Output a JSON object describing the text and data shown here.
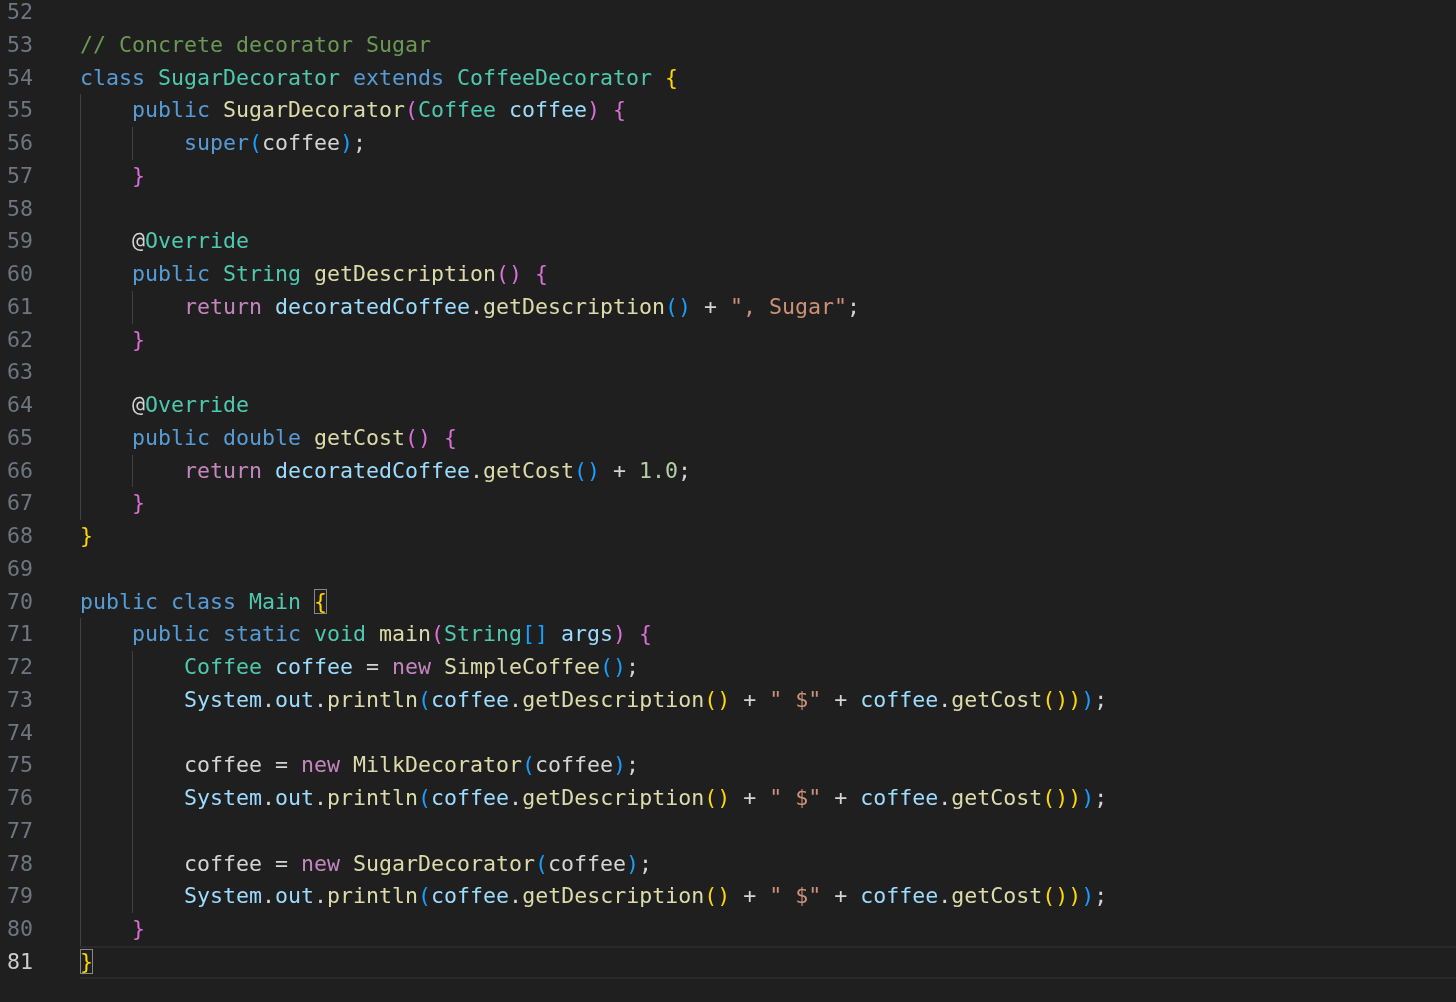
{
  "editor": {
    "lines": [
      {
        "number": "52",
        "current": false
      },
      {
        "number": "53",
        "current": false,
        "tokens": [
          {
            "text": "// Concrete decorator Sugar",
            "kind": "comment"
          }
        ]
      },
      {
        "number": "54",
        "current": false,
        "tokens": [
          {
            "text": "class ",
            "kind": "keyword"
          },
          {
            "text": "SugarDecorator ",
            "kind": "type"
          },
          {
            "text": "extends ",
            "kind": "keyword"
          },
          {
            "text": "CoffeeDecorator ",
            "kind": "type"
          },
          {
            "text": "{",
            "kind": "bracket1"
          }
        ]
      },
      {
        "number": "55",
        "current": false,
        "tokens": [
          {
            "text": "    public ",
            "kind": "keyword"
          },
          {
            "text": "SugarDecorator",
            "kind": "function"
          },
          {
            "text": "(",
            "kind": "bracket2"
          },
          {
            "text": "Coffee ",
            "kind": "type"
          },
          {
            "text": "coffee",
            "kind": "variable"
          },
          {
            "text": ") {",
            "kind": "bracket2"
          }
        ]
      },
      {
        "number": "56",
        "current": false,
        "tokens": [
          {
            "text": "        super",
            "kind": "keyword"
          },
          {
            "text": "(",
            "kind": "bracket3"
          },
          {
            "text": "coffee",
            "kind": "plain"
          },
          {
            "text": ")",
            "kind": "bracket3"
          },
          {
            "text": ";",
            "kind": "plain"
          }
        ]
      },
      {
        "number": "57",
        "current": false,
        "tokens": [
          {
            "text": "    }",
            "kind": "bracket2"
          }
        ]
      },
      {
        "number": "58",
        "current": false
      },
      {
        "number": "59",
        "current": false,
        "tokens": [
          {
            "text": "    @",
            "kind": "plain"
          },
          {
            "text": "Override",
            "kind": "type"
          }
        ]
      },
      {
        "number": "60",
        "current": false,
        "tokens": [
          {
            "text": "    public ",
            "kind": "keyword"
          },
          {
            "text": "String ",
            "kind": "type"
          },
          {
            "text": "getDescription",
            "kind": "function"
          },
          {
            "text": "() {",
            "kind": "bracket2"
          }
        ]
      },
      {
        "number": "61",
        "current": false,
        "tokens": [
          {
            "text": "        return ",
            "kind": "control"
          },
          {
            "text": "decoratedCoffee",
            "kind": "variable"
          },
          {
            "text": ".",
            "kind": "plain"
          },
          {
            "text": "getDescription",
            "kind": "function"
          },
          {
            "text": "()",
            "kind": "bracket3"
          },
          {
            "text": " + ",
            "kind": "plain"
          },
          {
            "text": "\", Sugar\"",
            "kind": "string"
          },
          {
            "text": ";",
            "kind": "plain"
          }
        ]
      },
      {
        "number": "62",
        "current": false,
        "tokens": [
          {
            "text": "    }",
            "kind": "bracket2"
          }
        ]
      },
      {
        "number": "63",
        "current": false
      },
      {
        "number": "64",
        "current": false,
        "tokens": [
          {
            "text": "    @",
            "kind": "plain"
          },
          {
            "text": "Override",
            "kind": "type"
          }
        ]
      },
      {
        "number": "65",
        "current": false,
        "tokens": [
          {
            "text": "    public double ",
            "kind": "keyword"
          },
          {
            "text": "getCost",
            "kind": "function"
          },
          {
            "text": "() {",
            "kind": "bracket2"
          }
        ]
      },
      {
        "number": "66",
        "current": false,
        "tokens": [
          {
            "text": "        return ",
            "kind": "control"
          },
          {
            "text": "decoratedCoffee",
            "kind": "variable"
          },
          {
            "text": ".",
            "kind": "plain"
          },
          {
            "text": "getCost",
            "kind": "function"
          },
          {
            "text": "()",
            "kind": "bracket3"
          },
          {
            "text": " + ",
            "kind": "plain"
          },
          {
            "text": "1.0",
            "kind": "number"
          },
          {
            "text": ";",
            "kind": "plain"
          }
        ]
      },
      {
        "number": "67",
        "current": false,
        "tokens": [
          {
            "text": "    }",
            "kind": "bracket2"
          }
        ]
      },
      {
        "number": "68",
        "current": false,
        "tokens": [
          {
            "text": "}",
            "kind": "bracket1"
          }
        ]
      },
      {
        "number": "69",
        "current": false
      },
      {
        "number": "70",
        "current": false,
        "tokens": [
          {
            "text": "public class ",
            "kind": "keyword"
          },
          {
            "text": "Main ",
            "kind": "type"
          },
          {
            "text": "{",
            "kind": "bracket1-matched"
          }
        ]
      },
      {
        "number": "71",
        "current": false,
        "tokens": [
          {
            "text": "    public static ",
            "kind": "keyword"
          },
          {
            "text": "void ",
            "kind": "type"
          },
          {
            "text": "main",
            "kind": "function"
          },
          {
            "text": "(",
            "kind": "bracket2"
          },
          {
            "text": "String",
            "kind": "type"
          },
          {
            "text": "[] ",
            "kind": "bracket3"
          },
          {
            "text": "args",
            "kind": "variable"
          },
          {
            "text": ") {",
            "kind": "bracket2"
          }
        ]
      },
      {
        "number": "72",
        "current": false,
        "tokens": [
          {
            "text": "        Coffee ",
            "kind": "type"
          },
          {
            "text": "coffee",
            "kind": "variable"
          },
          {
            "text": " = ",
            "kind": "plain"
          },
          {
            "text": "new ",
            "kind": "control"
          },
          {
            "text": "SimpleCoffee",
            "kind": "function"
          },
          {
            "text": "()",
            "kind": "bracket3"
          },
          {
            "text": ";",
            "kind": "plain"
          }
        ]
      },
      {
        "number": "73",
        "current": false,
        "tokens": [
          {
            "text": "        System",
            "kind": "variable"
          },
          {
            "text": ".",
            "kind": "plain"
          },
          {
            "text": "out",
            "kind": "variable"
          },
          {
            "text": ".",
            "kind": "plain"
          },
          {
            "text": "println",
            "kind": "function"
          },
          {
            "text": "(",
            "kind": "bracket3"
          },
          {
            "text": "coffee",
            "kind": "variable"
          },
          {
            "text": ".",
            "kind": "plain"
          },
          {
            "text": "getDescription",
            "kind": "function"
          },
          {
            "text": "()",
            "kind": "bracket1"
          },
          {
            "text": " + ",
            "kind": "plain"
          },
          {
            "text": "\" $\"",
            "kind": "string"
          },
          {
            "text": " + ",
            "kind": "plain"
          },
          {
            "text": "coffee",
            "kind": "variable"
          },
          {
            "text": ".",
            "kind": "plain"
          },
          {
            "text": "getCost",
            "kind": "function"
          },
          {
            "text": "())",
            "kind": "bracket1"
          },
          {
            "text": ")",
            "kind": "bracket3"
          },
          {
            "text": ";",
            "kind": "plain"
          }
        ]
      },
      {
        "number": "74",
        "current": false
      },
      {
        "number": "75",
        "current": false,
        "tokens": [
          {
            "text": "        coffee = ",
            "kind": "plain"
          },
          {
            "text": "new ",
            "kind": "control"
          },
          {
            "text": "MilkDecorator",
            "kind": "function"
          },
          {
            "text": "(",
            "kind": "bracket3"
          },
          {
            "text": "coffee",
            "kind": "plain"
          },
          {
            "text": ")",
            "kind": "bracket3"
          },
          {
            "text": ";",
            "kind": "plain"
          }
        ]
      },
      {
        "number": "76",
        "current": false,
        "tokens": [
          {
            "text": "        System",
            "kind": "variable"
          },
          {
            "text": ".",
            "kind": "plain"
          },
          {
            "text": "out",
            "kind": "variable"
          },
          {
            "text": ".",
            "kind": "plain"
          },
          {
            "text": "println",
            "kind": "function"
          },
          {
            "text": "(",
            "kind": "bracket3"
          },
          {
            "text": "coffee",
            "kind": "variable"
          },
          {
            "text": ".",
            "kind": "plain"
          },
          {
            "text": "getDescription",
            "kind": "function"
          },
          {
            "text": "()",
            "kind": "bracket1"
          },
          {
            "text": " + ",
            "kind": "plain"
          },
          {
            "text": "\" $\"",
            "kind": "string"
          },
          {
            "text": " + ",
            "kind": "plain"
          },
          {
            "text": "coffee",
            "kind": "variable"
          },
          {
            "text": ".",
            "kind": "plain"
          },
          {
            "text": "getCost",
            "kind": "function"
          },
          {
            "text": "())",
            "kind": "bracket1"
          },
          {
            "text": ")",
            "kind": "bracket3"
          },
          {
            "text": ";",
            "kind": "plain"
          }
        ]
      },
      {
        "number": "77",
        "current": false
      },
      {
        "number": "78",
        "current": false,
        "tokens": [
          {
            "text": "        coffee = ",
            "kind": "plain"
          },
          {
            "text": "new ",
            "kind": "control"
          },
          {
            "text": "SugarDecorator",
            "kind": "function"
          },
          {
            "text": "(",
            "kind": "bracket3"
          },
          {
            "text": "coffee",
            "kind": "plain"
          },
          {
            "text": ")",
            "kind": "bracket3"
          },
          {
            "text": ";",
            "kind": "plain"
          }
        ]
      },
      {
        "number": "79",
        "current": false,
        "tokens": [
          {
            "text": "        System",
            "kind": "variable"
          },
          {
            "text": ".",
            "kind": "plain"
          },
          {
            "text": "out",
            "kind": "variable"
          },
          {
            "text": ".",
            "kind": "plain"
          },
          {
            "text": "println",
            "kind": "function"
          },
          {
            "text": "(",
            "kind": "bracket3"
          },
          {
            "text": "coffee",
            "kind": "variable"
          },
          {
            "text": ".",
            "kind": "plain"
          },
          {
            "text": "getDescription",
            "kind": "function"
          },
          {
            "text": "()",
            "kind": "bracket1"
          },
          {
            "text": " + ",
            "kind": "plain"
          },
          {
            "text": "\" $\"",
            "kind": "string"
          },
          {
            "text": " + ",
            "kind": "plain"
          },
          {
            "text": "coffee",
            "kind": "variable"
          },
          {
            "text": ".",
            "kind": "plain"
          },
          {
            "text": "getCost",
            "kind": "function"
          },
          {
            "text": "())",
            "kind": "bracket1"
          },
          {
            "text": ")",
            "kind": "bracket3"
          },
          {
            "text": ";",
            "kind": "plain"
          }
        ]
      },
      {
        "number": "80",
        "current": false,
        "tokens": [
          {
            "text": "    }",
            "kind": "bracket2"
          }
        ]
      },
      {
        "number": "81",
        "current": true,
        "tokens": [
          {
            "text": "}",
            "kind": "bracket1-matched"
          }
        ]
      }
    ]
  }
}
